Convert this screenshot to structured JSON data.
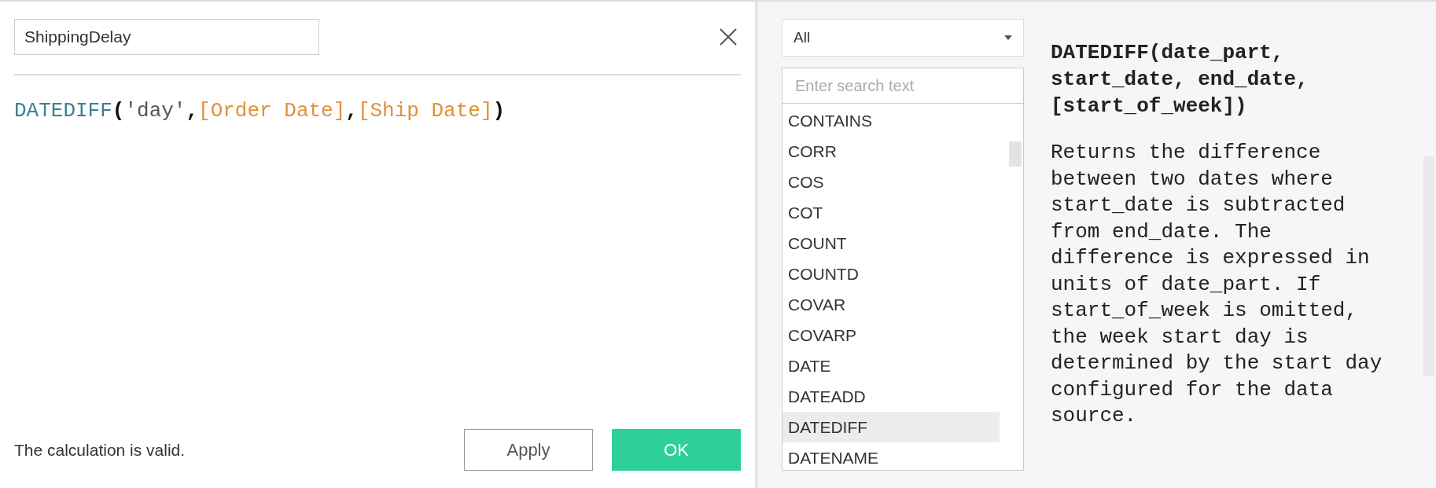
{
  "calculation_name": {
    "value": "ShippingDelay"
  },
  "formula": [
    {
      "kind": "function",
      "text": "DATEDIFF"
    },
    {
      "kind": "punct",
      "text": "("
    },
    {
      "kind": "string",
      "text": "'day'"
    },
    {
      "kind": "punct",
      "text": ","
    },
    {
      "kind": "field",
      "text": "[Order Date]"
    },
    {
      "kind": "punct",
      "text": ","
    },
    {
      "kind": "field",
      "text": "[Ship Date]"
    },
    {
      "kind": "punct",
      "text": ")"
    }
  ],
  "status": "The calculation is valid.",
  "buttons": [
    {
      "label": "Apply",
      "kind": "secondary"
    },
    {
      "label": "OK",
      "kind": "primary"
    }
  ],
  "function_panel": {
    "category": "All",
    "search": {
      "placeholder": "Enter search text"
    },
    "functions": [
      {
        "name": "CONTAINS",
        "selected": false
      },
      {
        "name": "CORR",
        "selected": false
      },
      {
        "name": "COS",
        "selected": false
      },
      {
        "name": "COT",
        "selected": false
      },
      {
        "name": "COUNT",
        "selected": false
      },
      {
        "name": "COUNTD",
        "selected": false
      },
      {
        "name": "COVAR",
        "selected": false
      },
      {
        "name": "COVARP",
        "selected": false
      },
      {
        "name": "DATE",
        "selected": false
      },
      {
        "name": "DATEADD",
        "selected": false
      },
      {
        "name": "DATEDIFF",
        "selected": true
      },
      {
        "name": "DATENAME",
        "selected": false
      }
    ],
    "syntax": "DATEDIFF(date_part, start_date, end_date, [start_of_week])",
    "description": "Returns the difference between two dates where start_date is subtracted from end_date. The difference is expressed in units of date_part. If start_of_week is omitted, the week start day is determined by the start day configured for the data source."
  }
}
